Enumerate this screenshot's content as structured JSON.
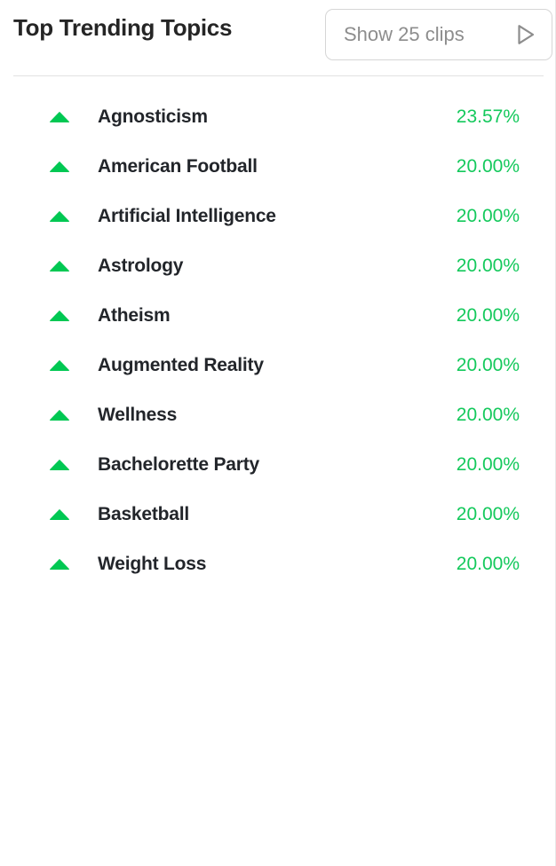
{
  "header": {
    "title": "Top Trending Topics",
    "clips_button_label": "Show 25 clips",
    "play_icon": "play-triangle-icon"
  },
  "colors": {
    "trend_up_green": "#00c853",
    "percent_green": "#14c95c",
    "title_dark": "#252525",
    "button_text_gray": "#8d8d8d",
    "border_gray": "#d6d6d6",
    "divider_gray": "#e2e2e2"
  },
  "list": {
    "trend_icon_name": "trend-up-icon",
    "rows": [
      {
        "topic": "Agnosticism",
        "percent": "23.57%",
        "trend": "up"
      },
      {
        "topic": "American Football",
        "percent": "20.00%",
        "trend": "up"
      },
      {
        "topic": "Artificial Intelligence",
        "percent": "20.00%",
        "trend": "up"
      },
      {
        "topic": "Astrology",
        "percent": "20.00%",
        "trend": "up"
      },
      {
        "topic": "Atheism",
        "percent": "20.00%",
        "trend": "up"
      },
      {
        "topic": "Augmented Reality",
        "percent": "20.00%",
        "trend": "up"
      },
      {
        "topic": "Wellness",
        "percent": "20.00%",
        "trend": "up"
      },
      {
        "topic": "Bachelorette Party",
        "percent": "20.00%",
        "trend": "up"
      },
      {
        "topic": "Basketball",
        "percent": "20.00%",
        "trend": "up"
      },
      {
        "topic": "Weight Loss",
        "percent": "20.00%",
        "trend": "up"
      }
    ]
  }
}
